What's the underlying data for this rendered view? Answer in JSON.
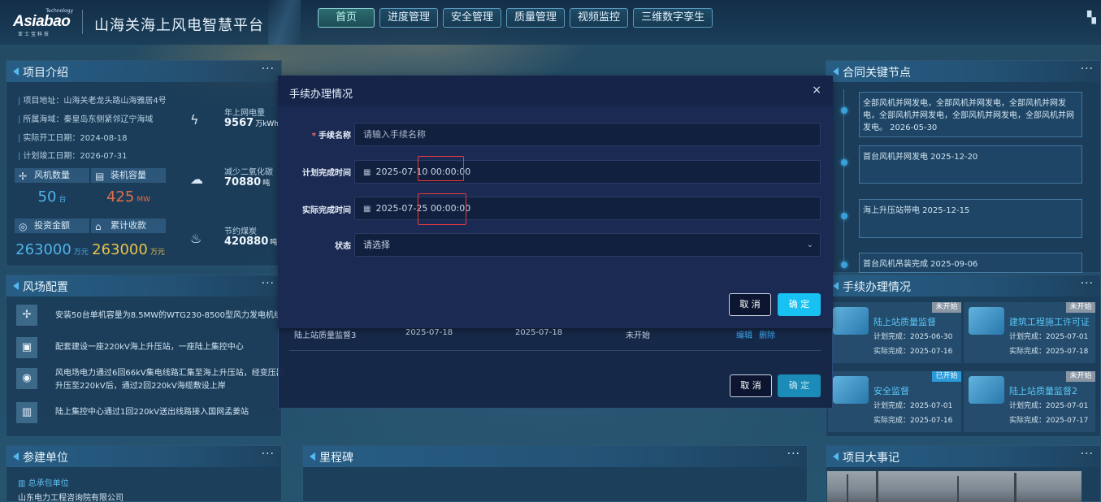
{
  "header": {
    "logo_tech": "Technology",
    "logo_main": "Asiabao",
    "logo_sub": "亚士宝科技",
    "title": "山海关海上风电智慧平台",
    "nav": [
      "首页",
      "进度管理",
      "安全管理",
      "质量管理",
      "视频监控",
      "三维数字孪生"
    ]
  },
  "project_intro": {
    "title": "项目介绍",
    "lines": [
      {
        "label": "项目地址：",
        "value": "山海关老龙头路山海雅居4号"
      },
      {
        "label": "所属海域：",
        "value": "秦皇岛东侧紧邻辽宁海域"
      },
      {
        "label": "实际开工日期：",
        "value": "2024-08-18"
      },
      {
        "label": "计划竣工日期：",
        "value": "2026-07-31"
      }
    ],
    "stats": [
      {
        "label": "风机数量",
        "value": "50",
        "unit": "台",
        "color": "#4fb3e8"
      },
      {
        "label": "装机容量",
        "value": "425",
        "unit": "MW",
        "color": "#e0704a"
      },
      {
        "label": "投资金额",
        "value": "263000",
        "unit": "万元",
        "color": "#4fb3e8"
      },
      {
        "label": "累计收款",
        "value": "263000",
        "unit": "万元",
        "color": "#e8c24a"
      }
    ],
    "eco": [
      {
        "label": "年上网电量",
        "value": "9567",
        "unit": "万kWh",
        "icon": "lightning-icon"
      },
      {
        "label": "减少二氧化碳",
        "value": "70880",
        "unit": "吨",
        "icon": "cloud-icon"
      },
      {
        "label": "节约煤炭",
        "value": "420880",
        "unit": "吨",
        "icon": "flame-icon"
      }
    ]
  },
  "wind_config": {
    "title": "风场配置",
    "items": [
      "安装50台单机容量为8.5MW的WTG230-8500型风力发电机组",
      "配套建设一座220kV海上升压站，一座陆上集控中心",
      "风电场电力通过6回66kV集电线路汇集至海上升压站，经变压器升压至220kV后，通过2回220kV海缆敷设上岸",
      "陆上集控中心通过1回220kV送出线路接入国网孟姜站"
    ]
  },
  "participants": {
    "title": "参建单位",
    "label": "总承包单位",
    "value": "山东电力工程咨询院有限公司"
  },
  "milestone": {
    "title": "里程碑"
  },
  "contract_nodes": {
    "title": "合同关键节点",
    "items": [
      "全部风机并网发电，全部风机并网发电，全部风机并网发电，全部风机并网发电，全部风机并网发电，全部风机并网发电。 2026-05-30",
      "首台风机并网发电 2025-12-20",
      "海上升压站带电 2025-12-15",
      "首台风机吊装完成 2025-09-06"
    ]
  },
  "procedures": {
    "title": "手续办理情况",
    "cards": [
      {
        "title": "陆上站质量监督",
        "plan": "计划完成：2025-06-30",
        "actual": "实际完成：2025-07-16",
        "badge": "未开始",
        "badge_color": "#8a96a4"
      },
      {
        "title": "建筑工程施工许可证",
        "plan": "计划完成：2025-07-01",
        "actual": "实际完成：2025-07-18",
        "badge": "未开始",
        "badge_color": "#8a96a4"
      },
      {
        "title": "安全监督",
        "plan": "计划完成：2025-07-01",
        "actual": "实际完成：2025-07-16",
        "badge": "已开始",
        "badge_color": "#2a9ad8"
      },
      {
        "title": "陆上站质量监督2",
        "plan": "计划完成：2025-07-01",
        "actual": "实际完成：2025-07-17",
        "badge": "未开始",
        "badge_color": "#8a96a4"
      }
    ]
  },
  "events": {
    "title": "项目大事记"
  },
  "modal": {
    "title": "手续办理情况",
    "close": "×",
    "name_label": "手续名称",
    "name_placeholder": "请输入手续名称",
    "plan_label": "计划完成时间",
    "plan_date": "2025-07-10",
    "plan_time": "00:00:00",
    "actual_label": "实际完成时间",
    "actual_date": "2025-07-25",
    "actual_time": "00:00:00",
    "status_label": "状态",
    "status_placeholder": "请选择",
    "cancel": "取 消",
    "ok": "确 定",
    "bg_row": {
      "name": "陆上站质量监督3",
      "plan": "2025-07-18",
      "actual": "2025-07-18",
      "status": "未开始",
      "edit": "编辑",
      "delete": "删除"
    },
    "bg_cancel": "取 消",
    "bg_ok": "确 定"
  }
}
